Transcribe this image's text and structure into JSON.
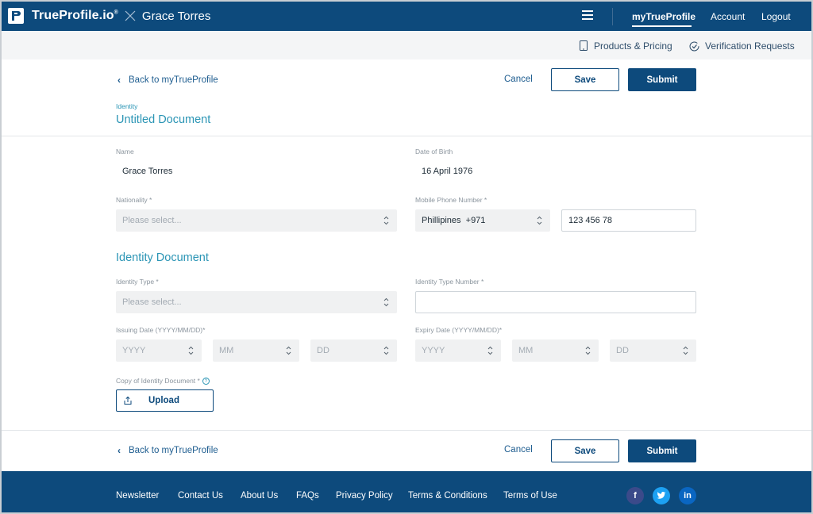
{
  "header": {
    "brand": "TrueProfile.io",
    "brand_mark": "®",
    "user_name": "Grace Torres",
    "nav": {
      "my_profile": "myTrueProfile",
      "account": "Account",
      "logout": "Logout"
    }
  },
  "subnav": {
    "products": "Products & Pricing",
    "verification": "Verification Requests"
  },
  "actions": {
    "back": "Back to myTrueProfile",
    "cancel": "Cancel",
    "save": "Save",
    "submit": "Submit"
  },
  "document": {
    "type": "Identity",
    "title": "Untitled Document"
  },
  "personal": {
    "name_label": "Name",
    "name_value": "Grace Torres",
    "dob_label": "Date of Birth",
    "dob_value": "16 April 1976",
    "nationality_label": "Nationality *",
    "nationality_placeholder": "Please select...",
    "phone_label": "Mobile Phone Number *",
    "phone_country": "Phillipines  +971",
    "phone_number": "123 456 78"
  },
  "identity": {
    "section_title": "Identity Document",
    "type_label": "Identity Type *",
    "type_placeholder": "Please select...",
    "number_label": "Identity Type Number *",
    "number_value": "",
    "issuing_label": "Issuing Date (YYYY/MM/DD)*",
    "expiry_label": "Expiry Date (YYYY/MM/DD)*",
    "year_placeholder": "YYYY",
    "month_placeholder": "MM",
    "day_placeholder": "DD",
    "copy_label": "Copy of Identity Document *",
    "help_glyph": "?",
    "upload": "Upload"
  },
  "footer": {
    "links": [
      "Newsletter",
      "Contact Us",
      "About Us",
      "FAQs",
      "Privacy Policy",
      "Terms & Conditions",
      "Terms of Use"
    ],
    "social": {
      "facebook": "f",
      "twitter": "t",
      "linkedin": "in"
    }
  },
  "colors": {
    "brand_blue": "#0d4a7c",
    "accent_teal": "#2b95b5",
    "facebook": "#3b4a8a",
    "twitter": "#1da1f2",
    "linkedin": "#0a66c2"
  }
}
